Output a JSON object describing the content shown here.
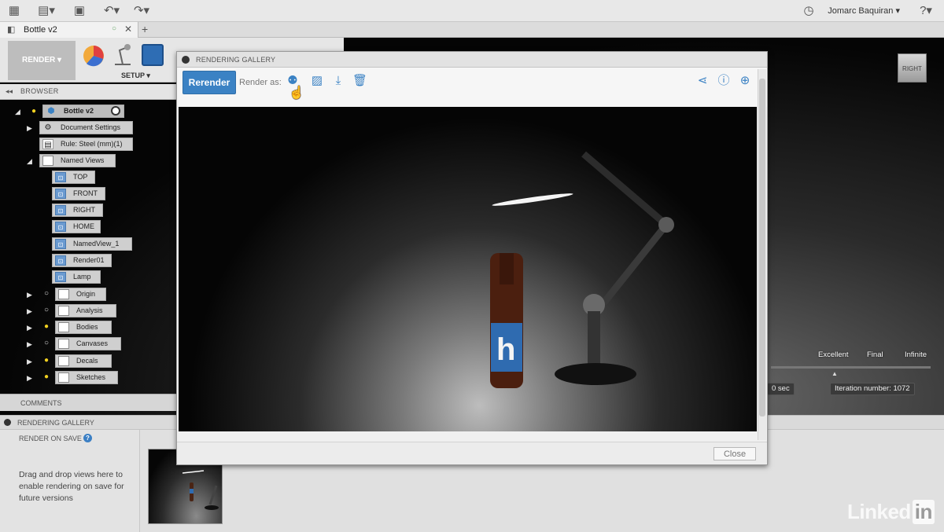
{
  "app": {
    "user_name": "Jomarc Baquiran ▾",
    "doc_tab_title": "Bottle v2",
    "workspace_label": "RENDER ▾",
    "setup_label": "SETUP ▾",
    "icons": {
      "app_grid": "grid-icon",
      "file": "file-icon",
      "save": "save-icon",
      "undo": "undo-icon",
      "redo": "redo-icon",
      "history": "clock-icon",
      "help": "help-icon"
    }
  },
  "browser": {
    "title": "BROWSER",
    "root": "Bottle v2",
    "items": [
      {
        "label": "Document Settings",
        "kind": "settings"
      },
      {
        "label": "Rule: Steel (mm)(1)",
        "kind": "rule"
      },
      {
        "label": "Named Views",
        "kind": "folder"
      }
    ],
    "named_views": [
      "TOP",
      "FRONT",
      "RIGHT",
      "HOME",
      "NamedView_1",
      "Render01",
      "Lamp"
    ],
    "folders": [
      "Origin",
      "Analysis",
      "Bodies",
      "Canvases",
      "Decals",
      "Sketches"
    ]
  },
  "comments": {
    "title": "COMMENTS"
  },
  "bottom_gallery": {
    "title": "RENDERING GALLERY",
    "render_on_save_label": "RENDER ON SAVE",
    "help_glyph": "?",
    "drag_text": "Drag and drop views here to enable rendering on save for future versions"
  },
  "dialog": {
    "title": "RENDERING GALLERY",
    "rerender_label": "Rerender",
    "render_as_label": "Render as:",
    "close_label": "Close",
    "image_decal_text": "h"
  },
  "render_stats": {
    "quality_levels": [
      "Excellent",
      "Final",
      "Infinite"
    ],
    "elapsed": "0 sec",
    "iteration": "Iteration number: 1072"
  },
  "viewcube": {
    "face": "RIGHT"
  },
  "watermark": {
    "text": "Linked",
    "badge": "in"
  },
  "colors": {
    "accent": "#3b82c4",
    "panel": "#e6e6e6"
  }
}
